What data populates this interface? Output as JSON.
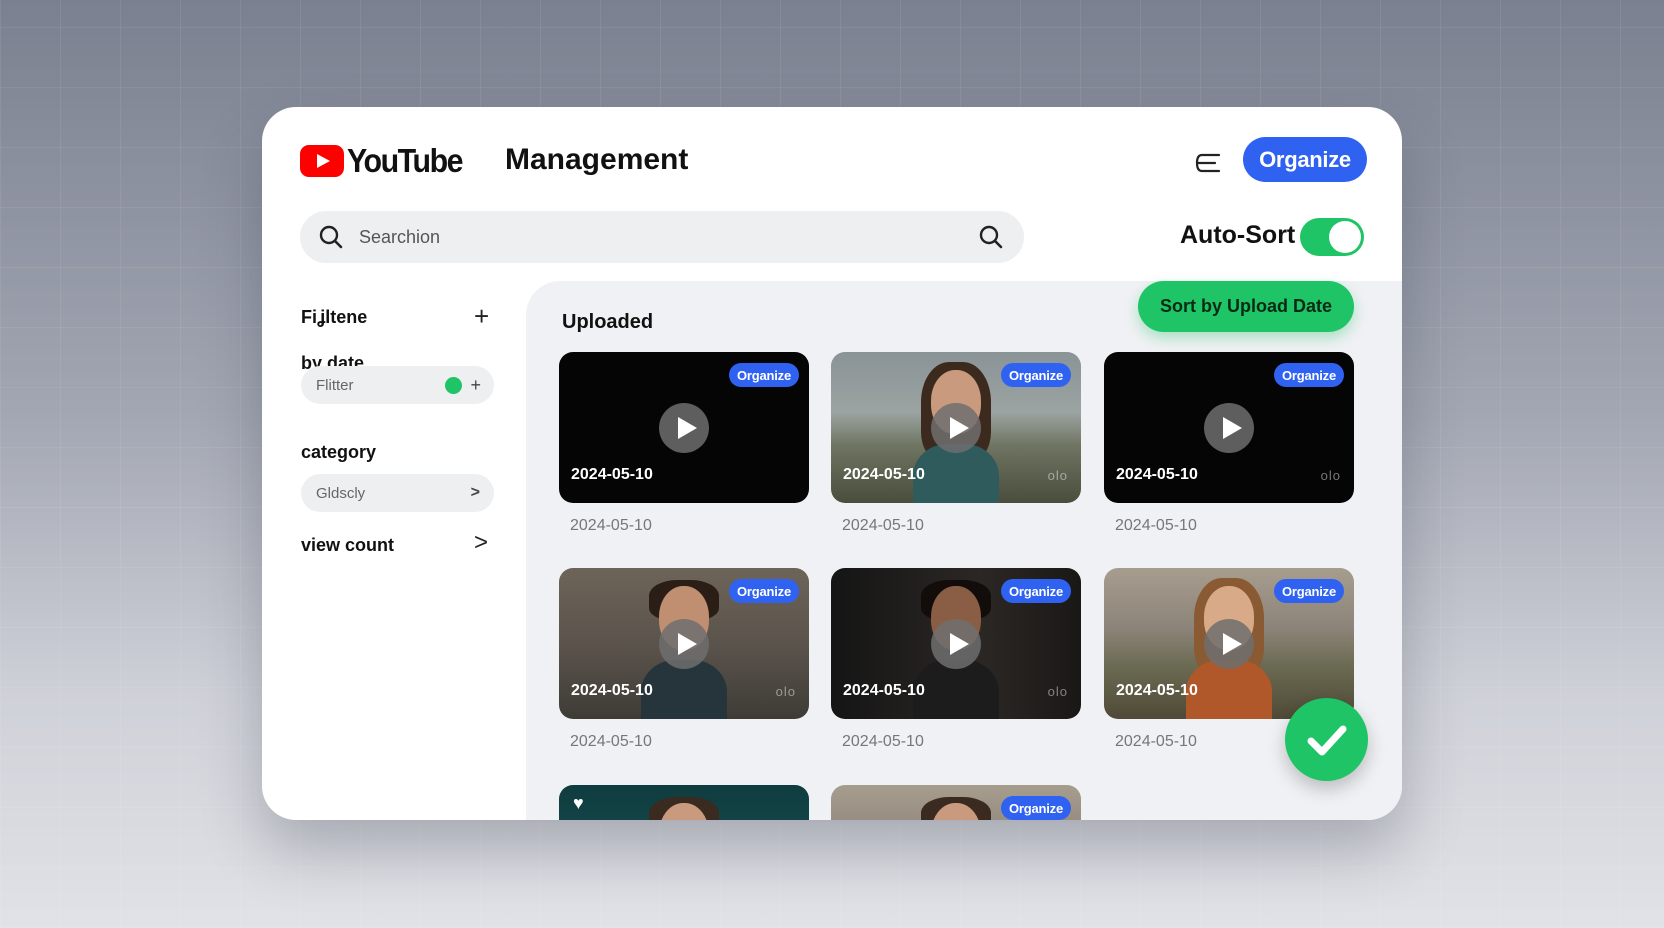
{
  "header": {
    "logo_text": "YouTube",
    "page_title": "Management",
    "organize_label": "Organize"
  },
  "search": {
    "placeholder": "Searchion"
  },
  "auto_sort": {
    "label": "Auto-Sort",
    "enabled": true
  },
  "sidebar": {
    "title": "Fiʝltene",
    "add_symbol": "+",
    "by_date": {
      "label": "by date",
      "pill_text": "Flitter",
      "pill_plus": "+"
    },
    "category": {
      "label": "category",
      "pill_text": "Gldscly",
      "pill_chevron": ">"
    },
    "view_count": {
      "label": "view count",
      "chevron": ">"
    }
  },
  "main": {
    "title": "Uploaded",
    "sort_button": "Sort by Upload Date",
    "videos": [
      {
        "badge": "Organize",
        "thumb_date": "2024-05-10",
        "meta": "",
        "date": "2024-05-10"
      },
      {
        "badge": "Organize",
        "thumb_date": "2024-05-10",
        "meta": "olo",
        "date": "2024-05-10"
      },
      {
        "badge": "Organize",
        "thumb_date": "2024-05-10",
        "meta": "olo",
        "date": "2024-05-10"
      },
      {
        "badge": "Organize",
        "thumb_date": "2024-05-10",
        "meta": "olo",
        "date": "2024-05-10"
      },
      {
        "badge": "Organize",
        "thumb_date": "2024-05-10",
        "meta": "olo",
        "date": "2024-05-10"
      },
      {
        "badge": "Organize",
        "thumb_date": "2024-05-10",
        "meta": "",
        "date": "2024-05-10"
      },
      {
        "badge": "",
        "thumb_date": "",
        "meta": "",
        "date": ""
      },
      {
        "badge": "Organize",
        "thumb_date": "",
        "meta": "",
        "date": ""
      }
    ]
  },
  "colors": {
    "accent_blue": "#2f62f0",
    "accent_green": "#1fc466",
    "brand_red": "#ff0000"
  },
  "icons": {
    "menu": "menu-icon",
    "search_left": "search-icon",
    "search_right": "search-icon",
    "play": "play-icon",
    "heart": "heart-icon",
    "check": "check-icon"
  }
}
